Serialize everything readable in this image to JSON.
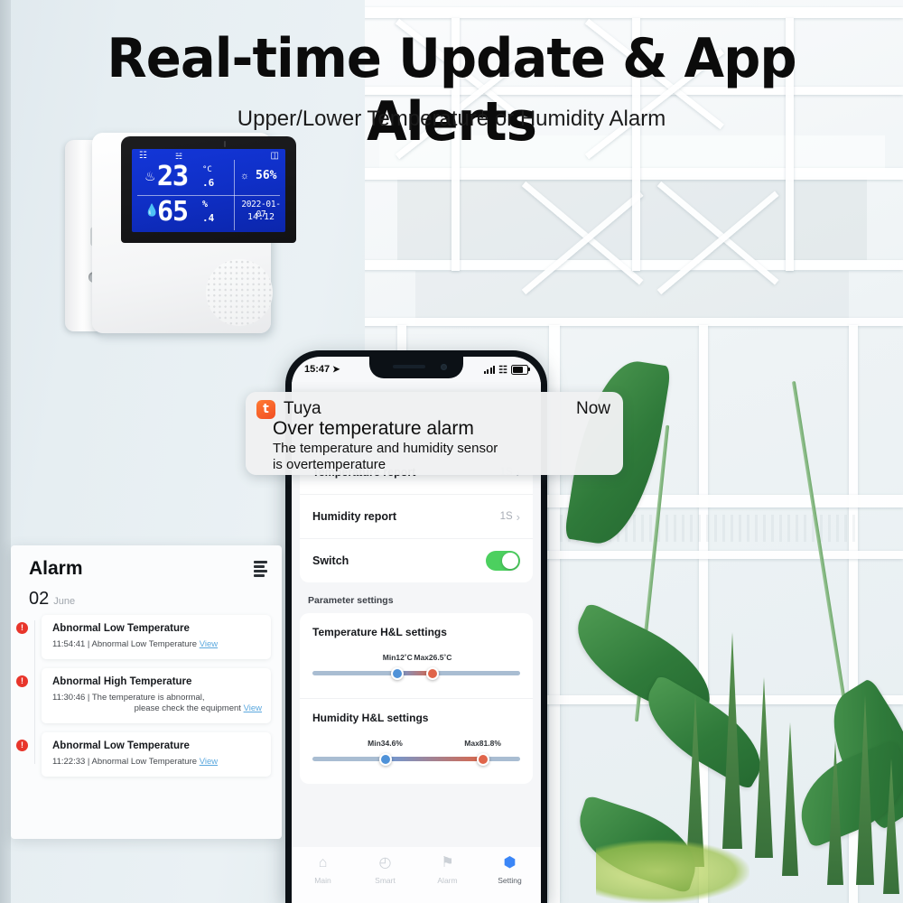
{
  "headline": "Real-time Update & App Alerts",
  "subhead": "Upper/Lower Temperature or Humidity Alarm",
  "device": {
    "name": "temperature-humidity-sensor",
    "lcd": {
      "wifi_icon": "wifi-icon",
      "comfort_icon": "comfort-level-icon",
      "battery_icon": "battery-icon",
      "thermometer_icon": "thermometer-icon",
      "humidity_drop_icon": "water-drop-icon",
      "sun_icon": "sun-icon",
      "temperature_main": "23",
      "temperature_unit": "°C",
      "temperature_decimal": ".6",
      "comfort_value": "56%",
      "humidity_main": "65",
      "humidity_unit": "%",
      "humidity_decimal": ".4",
      "date": "2022-01-07",
      "time": "14:12",
      "backlight_color": "#1336d8"
    }
  },
  "notification": {
    "app_icon": "tuya-app-icon",
    "app_name": "Tuya",
    "time": "Now",
    "title": "Over temperature alarm",
    "body_line1": "The temperature and humidity sensor",
    "body_line2": "is overtemperature",
    "icon_color": "#f14e23"
  },
  "phone": {
    "statusbar": {
      "time": "15:47",
      "location_icon": "location-arrow-icon",
      "signal_icon": "cellular-signal-icon",
      "wifi_icon": "wifi-icon",
      "battery_icon": "battery-icon"
    },
    "settings_rows": [
      {
        "label": "Temperature report",
        "value": "1S",
        "chevron": "›",
        "control": "chevron"
      },
      {
        "label": "Humidity report",
        "value": "1S",
        "chevron": "›",
        "control": "chevron"
      },
      {
        "label": "Switch",
        "value": "",
        "chevron": "",
        "control": "toggle",
        "toggle_on": true,
        "toggle_color": "#4cd05f"
      }
    ],
    "parameter_section_title": "Parameter settings",
    "sliders": [
      {
        "title": "Temperature H&L settings",
        "min_label": "Min12˚C",
        "max_label": "Max26.5˚C",
        "min_pct": 41,
        "max_pct": 58,
        "min_color": "#4f92d8",
        "max_color": "#e0654a"
      },
      {
        "title": "Humidity H&L settings",
        "min_label": "Min34.6%",
        "max_label": "Max81.8%",
        "min_pct": 35,
        "max_pct": 82,
        "min_color": "#4f92d8",
        "max_color": "#e0654a"
      }
    ],
    "tabs": [
      {
        "label": "Main",
        "icon": "home-icon",
        "glyph": "⌂",
        "active": false
      },
      {
        "label": "Smart",
        "icon": "clock-icon",
        "glyph": "◴",
        "active": false
      },
      {
        "label": "Alarm",
        "icon": "bell-icon",
        "glyph": "⚑",
        "active": false
      },
      {
        "label": "Setting",
        "icon": "gear-icon",
        "glyph": "⬢",
        "active": true
      }
    ],
    "active_tab_color": "#3b86f7"
  },
  "alarm_panel": {
    "title": "Alarm",
    "filter_icon": "filter-list-icon",
    "date_day": "02",
    "date_month": "June",
    "items": [
      {
        "badge_icon": "alert-icon",
        "title": "Abnormal Low Temperature",
        "time": "11:54:41",
        "separator": "|",
        "desc_line1": "Abnormal Low Temperature",
        "desc_line2": "",
        "view_label": "View"
      },
      {
        "badge_icon": "alert-icon",
        "title": "Abnormal High Temperature",
        "time": "11:30:46",
        "separator": "|",
        "desc_line1": "The temperature is abnormal,",
        "desc_line2": "please check the equipment",
        "view_label": "View"
      },
      {
        "badge_icon": "alert-icon",
        "title": "Abnormal Low Temperature",
        "time": "11:22:33",
        "separator": "|",
        "desc_line1": "Abnormal Low Temperature",
        "desc_line2": "",
        "view_label": "View"
      }
    ],
    "badge_color": "#e8352b",
    "link_color": "#5ba8de"
  }
}
